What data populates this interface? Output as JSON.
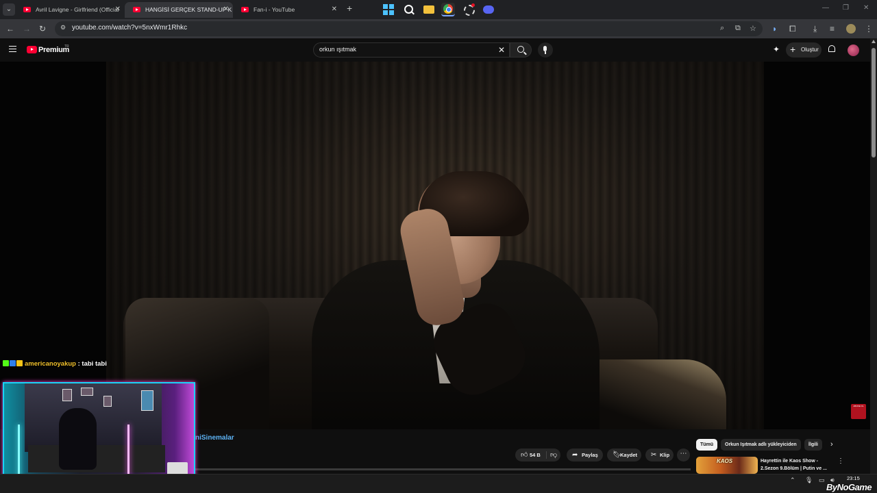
{
  "browser": {
    "tabs": [
      {
        "title": "Avril Lavigne - Girlfriend (Official",
        "active": false
      },
      {
        "title": "HANGİSİ GERÇEK STAND-UP K",
        "active": true
      },
      {
        "title": "Fan-i - YouTube",
        "active": false
      }
    ],
    "url": "youtube.com/watch?v=5nxWmr1Rhkc"
  },
  "youtube": {
    "logo_text": "Premium",
    "logo_country": "TR",
    "search_value": "orkun ışıtmak",
    "create_label": "Oluştur",
    "channel_name": "niSinemalar",
    "actions": {
      "likes": "54 B",
      "share": "Paylaş",
      "save": "Kaydet",
      "clip": "Klip"
    },
    "chips": [
      {
        "label": "Tümü",
        "selected": true
      },
      {
        "label": "Orkun Işıtmak adlı yükleyiciden",
        "selected": false
      },
      {
        "label": "İlgili",
        "selected": false
      }
    ],
    "recommendation": {
      "thumb_text": "KAOS",
      "title": "Hayrettin ile Kaos Show - 2.Sezon 9.Bölüm | Putin ve ..."
    },
    "subscribe_mark": "ABONE OL"
  },
  "stream": {
    "chat_user": "americanoyakup",
    "chat_message": " : tabi tabi",
    "badge_colors": [
      "#53fc18",
      "#2f80ed",
      "#f5c518"
    ],
    "webcam_border": "#1ad3f6",
    "watermark": "ByNoGame"
  },
  "taskbar": {
    "time": "23:15"
  },
  "colors": {
    "youtube_red": "#ff0033",
    "channel_link": "#5db3f5",
    "chat_user": "#f0c02b"
  }
}
